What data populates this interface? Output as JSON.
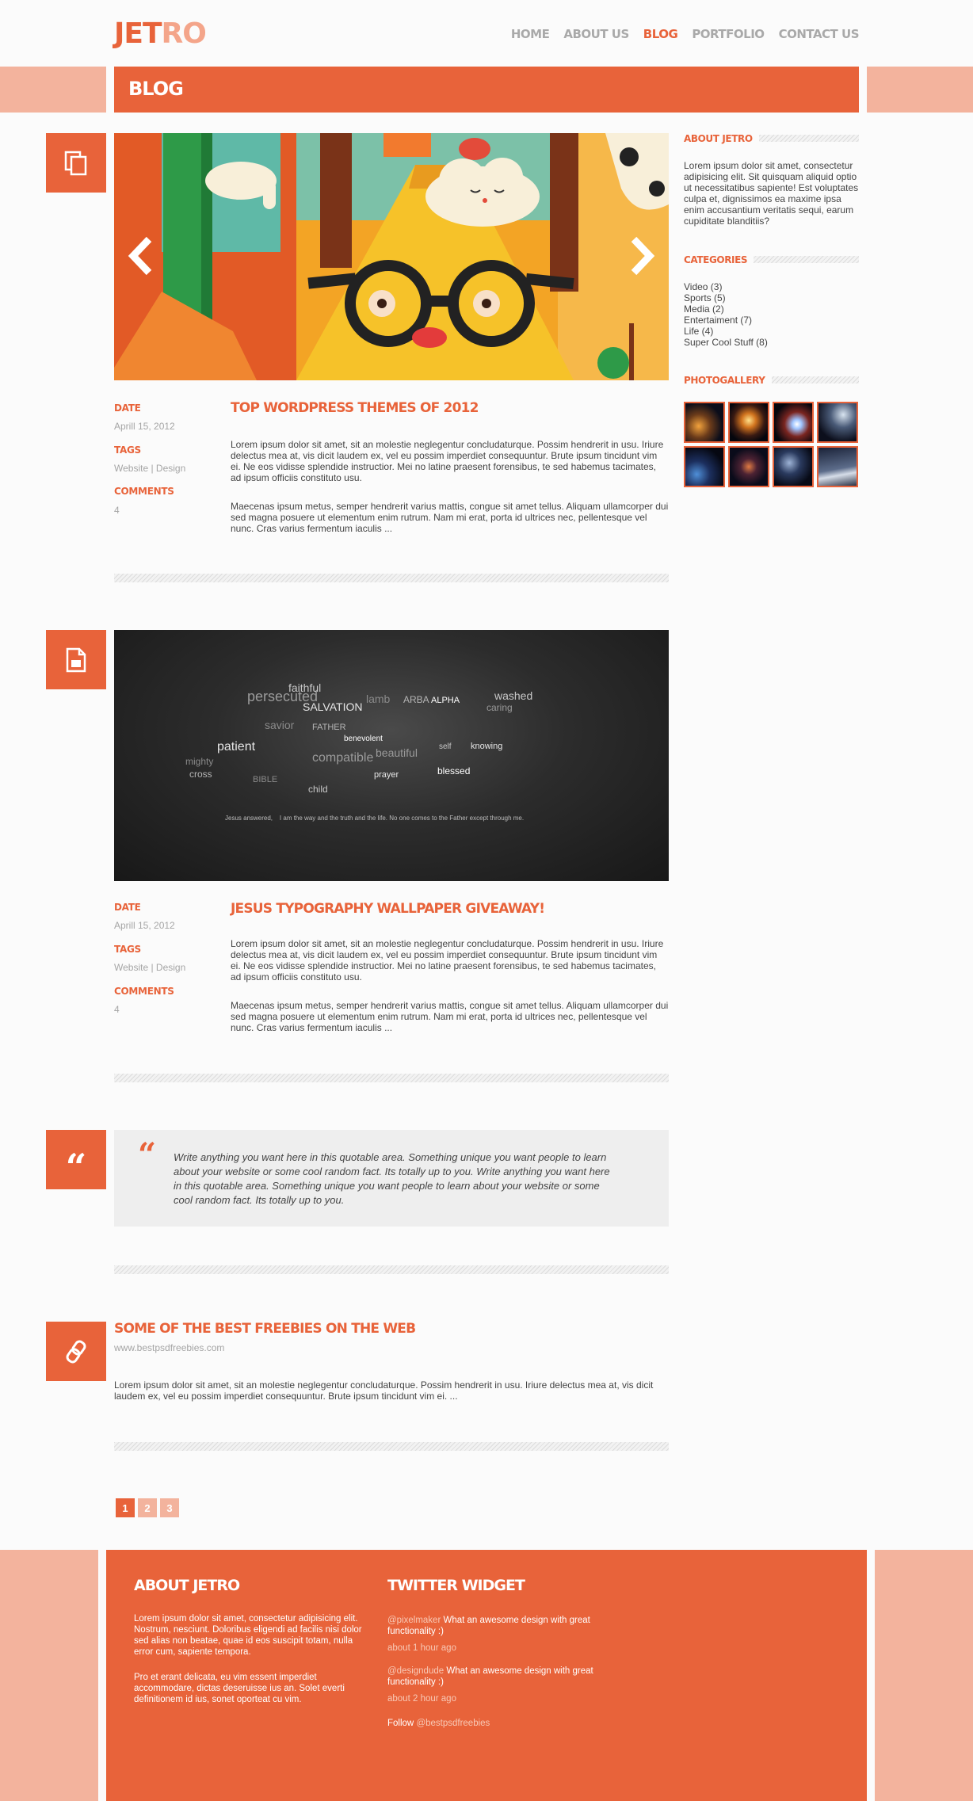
{
  "header": {
    "logo_part1": "JET",
    "logo_part2": "RO",
    "nav": [
      "HOME",
      "ABOUT US",
      "BLOG",
      "PORTFOLIO",
      "CONTACT US"
    ],
    "active_nav": "BLOG"
  },
  "page_title": "BLOG",
  "posts": [
    {
      "type": "gallery",
      "title": "TOP WORDPRESS THEMES OF 2012",
      "date_label": "DATE",
      "date": "Aprill 15, 2012",
      "tags_label": "TAGS",
      "tags": "Website | Design",
      "comments_label": "COMMENTS",
      "comments": "4",
      "paragraph1": "Lorem ipsum dolor sit amet, sit an molestie neglegentur concludaturque. Possim hendrerit in usu. Iriure delectus mea at, vis dicit laudem ex, vel eu possim imperdiet consequuntur. Brute ipsum tincidunt vim ei. Ne eos vidisse splendide instructior. Mei no latine praesent forensibus, te sed habemus tacimates, ad ipsum officiis constituto usu.",
      "paragraph2": "Maecenas ipsum metus, semper hendrerit varius mattis, congue sit amet tellus. Aliquam ullamcorper dui sed magna posuere ut elementum enim rutrum. Nam mi erat, porta id ultrices nec, pellentesque vel nunc. Cras varius fermentum iaculis ..."
    },
    {
      "type": "standard",
      "title": "JESUS TYPOGRAPHY WALLPAPER GIVEAWAY!",
      "date_label": "DATE",
      "date": "Aprill 15, 2012",
      "tags_label": "TAGS",
      "tags": "Website | Design",
      "comments_label": "COMMENTS",
      "comments": "4",
      "image_caption": "Jesus answered,    I am the way and the truth and the life. No one comes to the Father except through me.",
      "image_words": [
        "persecuted",
        "faithful",
        "SALVATION",
        "lamb",
        "ARBA",
        "ALPHA",
        "caring",
        "washed",
        "patient",
        "savior",
        "FATHER",
        "benevolent",
        "beautiful",
        "self",
        "knowing",
        "BIBLE",
        "cross",
        "blessed",
        "compatible",
        "child",
        "prayer",
        "mighty"
      ],
      "paragraph1": "Lorem ipsum dolor sit amet, sit an molestie neglegentur concludaturque. Possim hendrerit in usu. Iriure delectus mea at, vis dicit laudem ex, vel eu possim imperdiet consequuntur. Brute ipsum tincidunt vim ei. Ne eos vidisse splendide instructior. Mei no latine praesent forensibus, te sed habemus tacimates, ad ipsum officiis constituto usu.",
      "paragraph2": "Maecenas ipsum metus, semper hendrerit varius mattis, congue sit amet tellus. Aliquam ullamcorper dui sed magna posuere ut elementum enim rutrum. Nam mi erat, porta id ultrices nec, pellentesque vel nunc. Cras varius fermentum iaculis ..."
    },
    {
      "type": "quote",
      "quote_mark": "“",
      "quote": "Write anything you want here in this quotable area. Something unique you want people to learn about your website or some cool random fact. Its totally up to you. Write anything you want here in this quotable area. Something unique you want people to learn about your website or some cool random fact. Its totally up to you."
    },
    {
      "type": "link",
      "title": "SOME OF THE BEST FREEBIES ON THE WEB",
      "url": "www.bestpsdfreebies.com",
      "paragraph": "Lorem ipsum dolor sit amet, sit an molestie neglegentur concludaturque. Possim hendrerit in usu. Iriure delectus mea at, vis dicit laudem ex, vel eu possim imperdiet consequuntur. Brute ipsum tincidunt vim ei. ..."
    }
  ],
  "pagination": [
    "1",
    "2",
    "3"
  ],
  "sidebar": {
    "about_title": "ABOUT JETRO",
    "about_text": "Lorem ipsum dolor sit amet, consectetur adipisicing elit. Sit quisquam aliquid optio ut necessitatibus sapiente! Est voluptates culpa et, dignissimos ea maxime ipsa enim accusantium veritatis sequi, earum cupiditate blanditiis?",
    "categories_title": "CATEGORIES",
    "categories": [
      "Video (3)",
      "Sports (5)",
      "Media (2)",
      "Entertaiment (7)",
      "Life (4)",
      "Super Cool Stuff (8)"
    ],
    "gallery_title": "PHOTOGALLERY"
  },
  "footer": {
    "about_title": "ABOUT JETRO",
    "about_p1": "Lorem ipsum dolor sit amet, consectetur adipisicing elit. Nostrum, nesciunt. Doloribus eligendi ad facilis nisi dolor sed alias non beatae, quae id eos suscipit totam, nulla error cum, sapiente tempora.",
    "about_p2": "Pro et erant delicata, eu vim essent imperdiet accommodare, dictas deseruisse ius an. Solet everti definitionem id ius, sonet oporteat cu vim.",
    "twitter_title": "TWITTER WIDGET",
    "tweets": [
      {
        "handle": "@pixelmaker",
        "text": "What an awesome design with great functionality :)",
        "time": "about 1 hour ago"
      },
      {
        "handle": "@designdude",
        "text": "What an awesome design with great functionality :)",
        "time": "about 2 hour ago"
      }
    ],
    "follow_label": "Follow",
    "follow_handle": "@bestpsdfreebies"
  },
  "colors": {
    "accent": "#e8633a",
    "accent_light": "#f3b39d",
    "background": "#fbfbfb",
    "quote_bg": "#eeeeee"
  }
}
